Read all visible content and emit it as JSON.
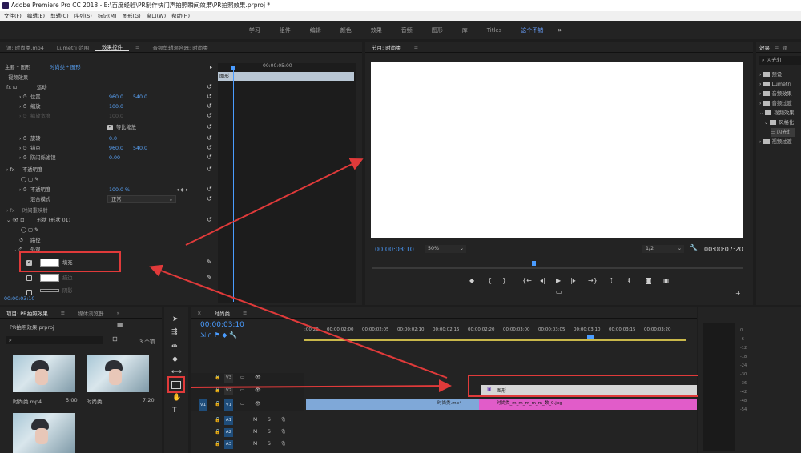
{
  "app": {
    "title": "Adobe Premiere Pro CC 2018 - E:\\百度经验\\PR制作快门声拍照瞬间效果\\PR拍照效果.prproj *",
    "menu": [
      "文件(F)",
      "编辑(E)",
      "剪辑(C)",
      "序列(S)",
      "标记(M)",
      "图形(G)",
      "窗口(W)",
      "帮助(H)"
    ]
  },
  "workspaces": {
    "items": [
      "学习",
      "组件",
      "编辑",
      "颜色",
      "效果",
      "音频",
      "图形",
      "库",
      "Titles",
      "这个不错"
    ],
    "active_index": 9,
    "more": "»"
  },
  "effect_controls": {
    "tabs": [
      "源: 时尚类.mp4",
      "Lumetri 范围",
      "效果控件",
      "音频剪辑混合器: 时尚类"
    ],
    "active_tab": 2,
    "breadcrumb_master": "主要 * 图形",
    "breadcrumb_clip": "时尚类 * 图形",
    "section_video": "视频效果",
    "motion": {
      "label": "运动",
      "position_label": "位置",
      "position_x": "960.0",
      "position_y": "540.0",
      "scale_label": "缩放",
      "scale_value": "100.0",
      "scale_width_label": "缩放宽度",
      "scale_width_value": "100.0",
      "uniform_scale_label": "等比缩放",
      "rotation_label": "旋转",
      "rotation_value": "0.0",
      "anchor_label": "锚点",
      "anchor_x": "960.0",
      "anchor_y": "540.0",
      "antiflicker_label": "防闪烁滤镜",
      "antiflicker_value": "0.00"
    },
    "opacity": {
      "label": "不透明度",
      "opacity_label": "不透明度",
      "opacity_value": "100.0 %",
      "blend_label": "混合模式",
      "blend_value": "正常"
    },
    "time_remap_label": "时间重映射",
    "shape": {
      "label": "形状 (形状 01)",
      "path_label": "路径",
      "appearance_label": "外观",
      "fill_label": "填充",
      "stroke_label": "描边",
      "shadow_label": "阴影"
    },
    "timeline_timecode": "00:00:05:00",
    "clip_label": "图形",
    "current_time": "00:00:03:10"
  },
  "program_monitor": {
    "title": "节目: 时尚类",
    "timecode": "00:00:03:10",
    "zoom": "50%",
    "resolution": "1/2",
    "duration": "00:00:07:20"
  },
  "effects_panel": {
    "tab": "效果",
    "tab2": "题",
    "search_value": "闪光灯",
    "items": [
      "预设",
      "Lumetri",
      "音频效果",
      "音频过渡",
      "视频效果",
      "风格化",
      "闪光灯",
      "视频过渡"
    ]
  },
  "project": {
    "tabs": [
      "项目: PR拍照效果",
      "媒体浏览器"
    ],
    "filename": "PR拍照效果.prproj",
    "count": "3 个项",
    "items": [
      {
        "name": "时尚类.mp4",
        "duration": "5:00"
      },
      {
        "name": "时尚类",
        "duration": "7:20"
      },
      {
        "name": "",
        "duration": ""
      }
    ]
  },
  "timeline": {
    "title": "时尚类",
    "timecode": "00:00:03:10",
    "ruler": [
      ":00:20",
      "00:00:02:00",
      "00:00:02:05",
      "00:00:02:10",
      "00:00:02:15",
      "00:00:02:20",
      "00:00:03:00",
      "00:00:03:05",
      "00:00:03:10",
      "00:00:03:15",
      "00:00:03:20"
    ],
    "tracks_video": [
      "V3",
      "V2",
      "V1"
    ],
    "tracks_audio": [
      "A1",
      "A2",
      "A3"
    ],
    "source_patch": "V1",
    "clip_graphic": "图形",
    "clip_video": "时尚类.mp4",
    "clip_image": "时尚类_m_m_m_m_m_数_0.jpg",
    "meter_labels": [
      "0",
      "-6",
      "-12",
      "-18",
      "-24",
      "-30",
      "-36",
      "-42",
      "-48",
      "-54"
    ]
  },
  "colors": {
    "accent": "#4a9cff",
    "annotation": "#e03a3a",
    "graphic_clip": "#d6d6d6",
    "image_clip": "#e15cc9",
    "video_clip": "#7fa8d8"
  }
}
